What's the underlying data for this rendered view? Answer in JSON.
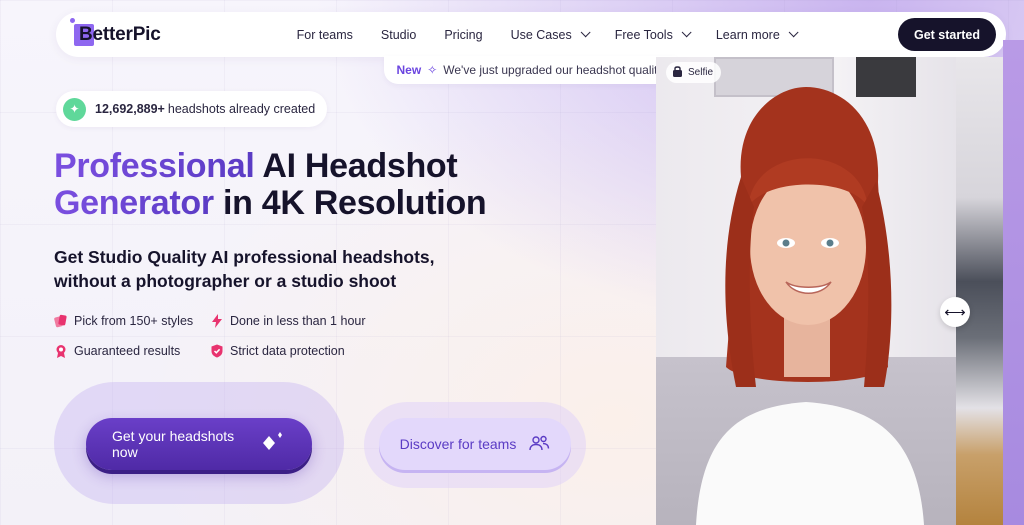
{
  "nav": {
    "logo_text": "BetterPic",
    "items": [
      {
        "label": "For teams",
        "dropdown": false
      },
      {
        "label": "Studio",
        "dropdown": false
      },
      {
        "label": "Pricing",
        "dropdown": false
      },
      {
        "label": "Use Cases",
        "dropdown": true
      },
      {
        "label": "Free Tools",
        "dropdown": true
      },
      {
        "label": "Learn more",
        "dropdown": true
      }
    ],
    "cta_label": "Get started"
  },
  "banner": {
    "badge": "New",
    "text": "We've just upgraded our headshot quality",
    "icon": "sparkle-icon"
  },
  "counter": {
    "count": "12,692,889+",
    "text": "headshots already created",
    "icon": "sparkle-icon"
  },
  "hero": {
    "headline_accent_1": "Professional",
    "headline_rest_1": " AI Headshot",
    "headline_accent_2": "Generator",
    "headline_rest_2": " in 4K Resolution",
    "subheadline_1": "Get Studio Quality AI professional headshots,",
    "subheadline_2": "without a photographer or a studio shoot"
  },
  "features": [
    {
      "label": "Pick from 150+ styles",
      "icon": "cards-icon"
    },
    {
      "label": "Done in less than 1 hour",
      "icon": "lightning-icon"
    },
    {
      "label": "Guaranteed results",
      "icon": "award-icon"
    },
    {
      "label": "Strict data protection",
      "icon": "shield-icon"
    }
  ],
  "buttons": {
    "primary_label": "Get your headshots now",
    "secondary_label": "Discover for teams"
  },
  "preview": {
    "badge_label": "Selfie"
  },
  "colors": {
    "accent": "#6b45e0",
    "primary_button": "#5a33b8",
    "secondary_button": "#e3d8fb",
    "dark": "#16132b",
    "success": "#5fd89a",
    "feature_icon": "#e8336f"
  }
}
